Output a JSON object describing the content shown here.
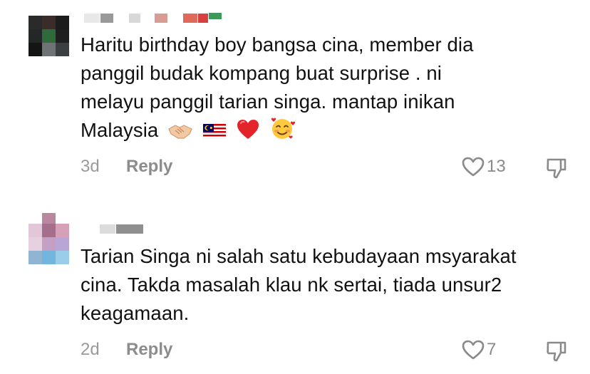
{
  "comments": [
    {
      "text_line1": "Haritu birthday boy bangsa cina, member dia",
      "text_line2": "panggil budak kompang buat surprise . ni",
      "text_line3": "melayu panggil tarian singa. mantap inikan",
      "text_line4": "Malaysia",
      "emojis": [
        "handshake-emoji",
        "malaysia-flag-emoji",
        "red-heart-emoji",
        "smiling-face-with-hearts-emoji"
      ],
      "time": "3d",
      "reply_label": "Reply",
      "likes": "13"
    },
    {
      "text_line1": "Tarian Singa ni salah satu kebudayaan msyarakat",
      "text_line2": "cina. Takda masalah klau nk sertai, tiada unsur2",
      "text_line3": "keagamaan.",
      "time": "2d",
      "reply_label": "Reply",
      "likes": "7"
    }
  ],
  "colors": {
    "text": "#111111",
    "meta": "#9a9a9a",
    "background": "#ffffff"
  }
}
